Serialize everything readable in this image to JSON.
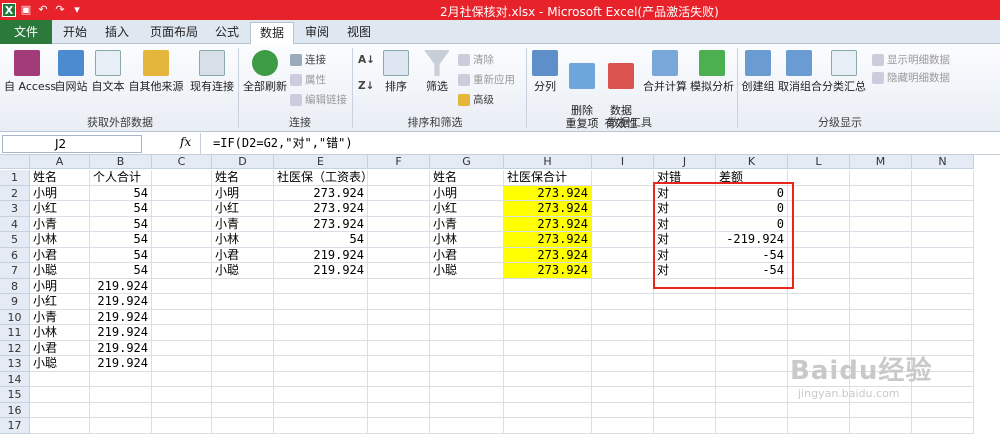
{
  "window": {
    "title": "2月社保核对.xlsx - Microsoft Excel(产品激活失败)"
  },
  "tabs": [
    "文件",
    "开始",
    "插入",
    "页面布局",
    "公式",
    "数据",
    "审阅",
    "视图"
  ],
  "active_tab": "数据",
  "ribbon": {
    "get_external": {
      "label": "获取外部数据",
      "buttons": [
        "自 Access",
        "自网站",
        "自文本",
        "自其他来源",
        "现有连接"
      ]
    },
    "connections": {
      "label": "连接",
      "refresh_all": "全部刷新",
      "items": [
        "连接",
        "属性",
        "编辑链接"
      ]
    },
    "sort_filter": {
      "label": "排序和筛选",
      "sort": "排序",
      "filter": "筛选",
      "items": [
        "清除",
        "重新应用",
        "高级"
      ]
    },
    "data_tools": {
      "label": "数据工具",
      "buttons": [
        "分列",
        "删除\n重复项",
        "数据\n有效性",
        "合并计算",
        "模拟分析"
      ]
    },
    "outline": {
      "label": "分级显示",
      "buttons": [
        "创建组",
        "取消组合",
        "分类汇总"
      ],
      "items": [
        "显示明细数据",
        "隐藏明细数据"
      ]
    }
  },
  "formula_bar": {
    "name_box": "J2",
    "fx": "fx",
    "formula": "=IF(D2=G2,\"对\",\"错\")"
  },
  "columns": [
    "A",
    "B",
    "C",
    "D",
    "E",
    "F",
    "G",
    "H",
    "I",
    "J",
    "K",
    "L",
    "M",
    "N"
  ],
  "rows": [
    1,
    2,
    3,
    4,
    5,
    6,
    7,
    8,
    9,
    10,
    11,
    12,
    13,
    14,
    15,
    16,
    17
  ],
  "sheet": {
    "A": [
      "姓名",
      "小明",
      "小红",
      "小青",
      "小林",
      "小君",
      "小聪",
      "小明",
      "小红",
      "小青",
      "小林",
      "小君",
      "小聪"
    ],
    "B": [
      "个人合计",
      "54",
      "54",
      "54",
      "54",
      "54",
      "54",
      "219.924",
      "219.924",
      "219.924",
      "219.924",
      "219.924",
      "219.924"
    ],
    "D": [
      "姓名",
      "小明",
      "小红",
      "小青",
      "小林",
      "小君",
      "小聪"
    ],
    "E": [
      "社医保（工资表）",
      "273.924",
      "273.924",
      "273.924",
      "54",
      "219.924",
      "219.924"
    ],
    "G": [
      "姓名",
      "小明",
      "小红",
      "小青",
      "小林",
      "小君",
      "小聪"
    ],
    "H": [
      "社医保合计",
      "273.924",
      "273.924",
      "273.924",
      "273.924",
      "273.924",
      "273.924"
    ],
    "J": [
      "对错",
      "对",
      "对",
      "对",
      "对",
      "对",
      "对"
    ],
    "K": [
      "差额",
      "0",
      "0",
      "0",
      "-219.924",
      "-54",
      "-54"
    ]
  },
  "colors": {
    "title_bar": "#e7222a",
    "highlight": "#ffff00",
    "annotation_box": "#e8261b",
    "file_tab": "#2b7a3c"
  },
  "watermark": {
    "brand": "Baidu经验",
    "url": "jingyan.baidu.com"
  }
}
